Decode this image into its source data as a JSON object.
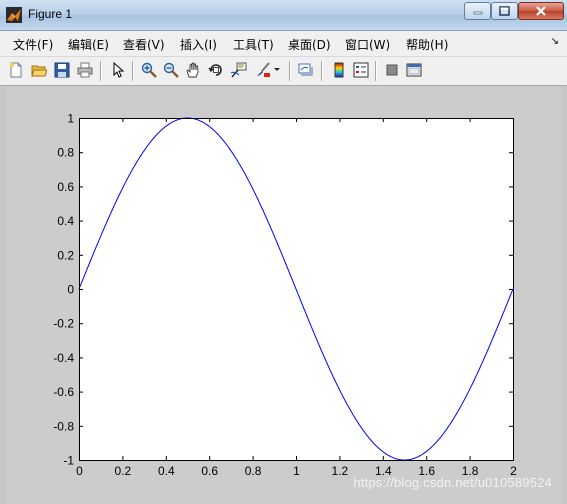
{
  "window": {
    "title": "Figure 1"
  },
  "menu": [
    {
      "label": "文件(F)"
    },
    {
      "label": "编辑(E)"
    },
    {
      "label": "查看(V)"
    },
    {
      "label": "插入(I)"
    },
    {
      "label": "工具(T)"
    },
    {
      "label": "桌面(D)"
    },
    {
      "label": "窗口(W)"
    },
    {
      "label": "帮助(H)"
    }
  ],
  "toolbar": [
    {
      "icon": "new-figure-icon"
    },
    {
      "icon": "open-file-icon"
    },
    {
      "icon": "save-icon"
    },
    {
      "icon": "print-icon"
    },
    {
      "icon": "edit-plot-arrow-icon"
    },
    {
      "icon": "zoom-in-icon"
    },
    {
      "icon": "zoom-out-icon"
    },
    {
      "icon": "pan-hand-icon"
    },
    {
      "icon": "rotate-3d-icon"
    },
    {
      "icon": "data-cursor-icon"
    },
    {
      "icon": "brush-icon"
    },
    {
      "icon": "link-plot-icon"
    },
    {
      "icon": "colorbar-icon"
    },
    {
      "icon": "legend-icon"
    },
    {
      "icon": "hide-plot-tools-icon"
    },
    {
      "icon": "show-plot-tools-icon"
    }
  ],
  "chart_data": {
    "type": "line",
    "title": "",
    "xlabel": "",
    "ylabel": "",
    "xlim": [
      0,
      2
    ],
    "ylim": [
      -1,
      1
    ],
    "xticks": [
      "0",
      "0.2",
      "0.4",
      "0.6",
      "0.8",
      "1",
      "1.2",
      "1.4",
      "1.6",
      "1.8",
      "2"
    ],
    "yticks": [
      "1",
      "0.8",
      "0.6",
      "0.4",
      "0.2",
      "0",
      "-0.2",
      "-0.4",
      "-0.6",
      "-0.8",
      "-1"
    ],
    "series": [
      {
        "function": "y = sin(pi*x)",
        "color": "#0000ff",
        "x": [
          0,
          0.1,
          0.2,
          0.3,
          0.4,
          0.5,
          0.6,
          0.7,
          0.8,
          0.9,
          1.0,
          1.1,
          1.2,
          1.3,
          1.4,
          1.5,
          1.6,
          1.7,
          1.8,
          1.9,
          2.0
        ],
        "y": [
          0,
          0.309,
          0.588,
          0.809,
          0.951,
          1,
          0.951,
          0.809,
          0.588,
          0.309,
          0,
          -0.309,
          -0.588,
          -0.809,
          -0.951,
          -1,
          -0.951,
          -0.809,
          -0.588,
          -0.309,
          0
        ]
      }
    ],
    "grid": false,
    "colors": {
      "figure_bg": "#cccccc",
      "axes_bg": "#ffffff",
      "line": "#0000ff"
    }
  },
  "watermark": "https://blog.csdn.net/u010589524"
}
